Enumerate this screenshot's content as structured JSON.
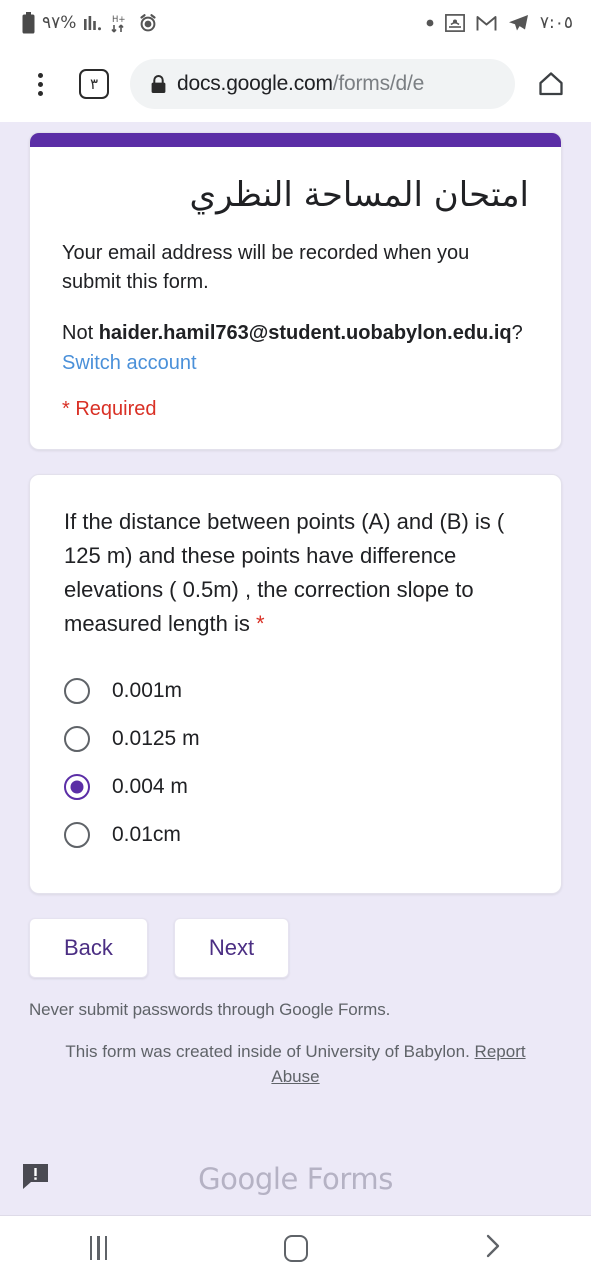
{
  "status_bar": {
    "battery_icon": "battery-icon",
    "battery_percent": "٩٧%",
    "signal_icon": "signal-bars-icon",
    "network_icon": "network-hplus-icon",
    "alarm_icon": "alarm-clock-icon",
    "dot_icon": "dot-icon",
    "screenshot_icon": "screenshot-icon",
    "gmail_icon": "gmail-icon",
    "telegram_icon": "telegram-icon",
    "time": "٧:٠٥"
  },
  "browser": {
    "menu_icon": "overflow-menu-icon",
    "tab_count": "٣",
    "lock_icon": "lock-icon",
    "url_domain": "docs.google.com",
    "url_path": "/forms/d/e",
    "home_icon": "home-icon"
  },
  "form": {
    "title": "امتحان المساحة النظري",
    "email_note": "Your email address will be recorded when you submit this form.",
    "not_prefix": "Not ",
    "account_email": "haider.hamil763@student.uobabylon.edu.iq",
    "not_suffix": "?",
    "switch_account": "Switch account",
    "required_note": "* Required",
    "header_color": "#5b2ea6"
  },
  "question": {
    "text": "If the distance between points (A) and (B) is ( 125 m) and these points have difference elevations ( 0.5m) , the correction slope to measured length is",
    "required_star": "*",
    "options": [
      {
        "label": "0.001m",
        "selected": false
      },
      {
        "label": "0.0125 m",
        "selected": false
      },
      {
        "label": "0.004 m",
        "selected": true
      },
      {
        "label": "0.01cm",
        "selected": false
      }
    ]
  },
  "navigation": {
    "back_label": "Back",
    "next_label": "Next"
  },
  "footer": {
    "disclaimer": "Never submit passwords through Google Forms.",
    "created_text": "This form was created inside of University of Babylon.",
    "report_abuse": "Report Abuse",
    "brand_strong": "Google",
    "brand_light": " Forms",
    "feedback_icon": "feedback-bubble-icon"
  },
  "system_nav": {
    "recents_icon": "recents-icon",
    "home_icon": "home-button-icon",
    "back_icon": "back-chevron-icon"
  }
}
